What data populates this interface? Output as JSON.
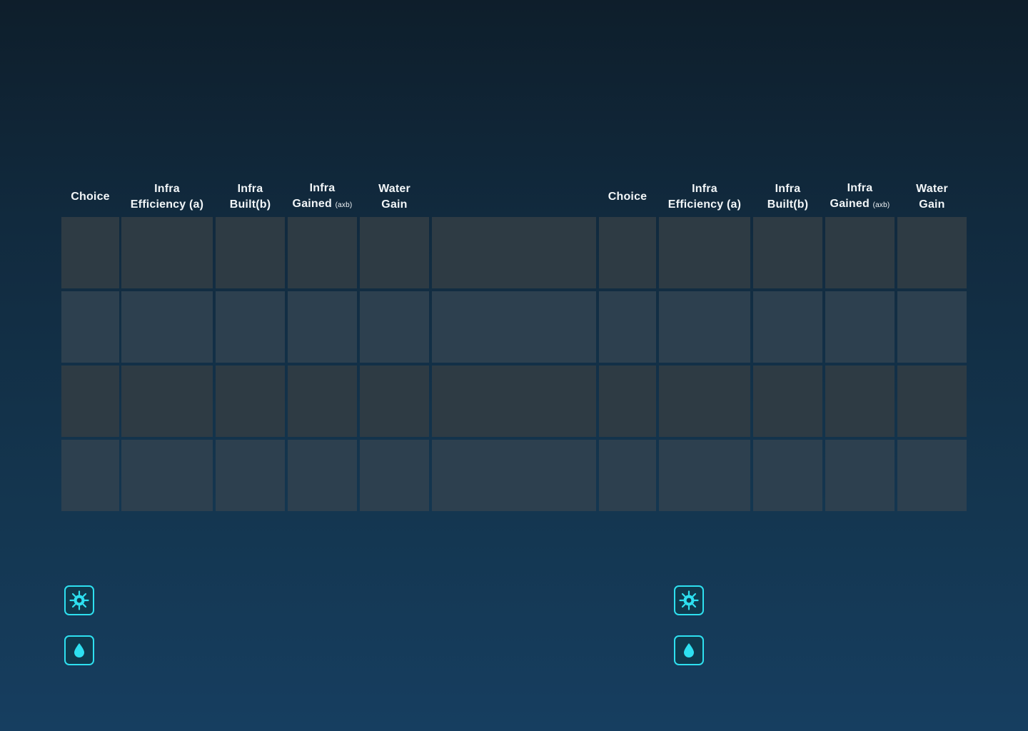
{
  "headers": {
    "left": {
      "choice": "Choice",
      "infra_eff_1": "Infra",
      "infra_eff_2": "Efficiency (a)",
      "infra_built_1": "Infra",
      "infra_built_2": "Built(b)",
      "infra_gained_1": "Infra",
      "infra_gained_2": "Gained",
      "infra_gained_sub": "(axb)",
      "water_1": "Water",
      "water_2": "Gain"
    },
    "right": {
      "choice": "Choice",
      "infra_eff_1": "Infra",
      "infra_eff_2": "Efficiency (a)",
      "infra_built_1": "Infra",
      "infra_built_2": "Built(b)",
      "infra_gained_1": "Infra",
      "infra_gained_2": "Gained",
      "infra_gained_sub": "(axb)",
      "water_1": "Water",
      "water_2": "Gain"
    }
  },
  "table": {
    "rows": 4,
    "cells_empty": true
  },
  "icons": {
    "infra": "infrastructure-gear-icon",
    "water": "water-drop-icon",
    "accent_color": "#2ee0f0"
  }
}
